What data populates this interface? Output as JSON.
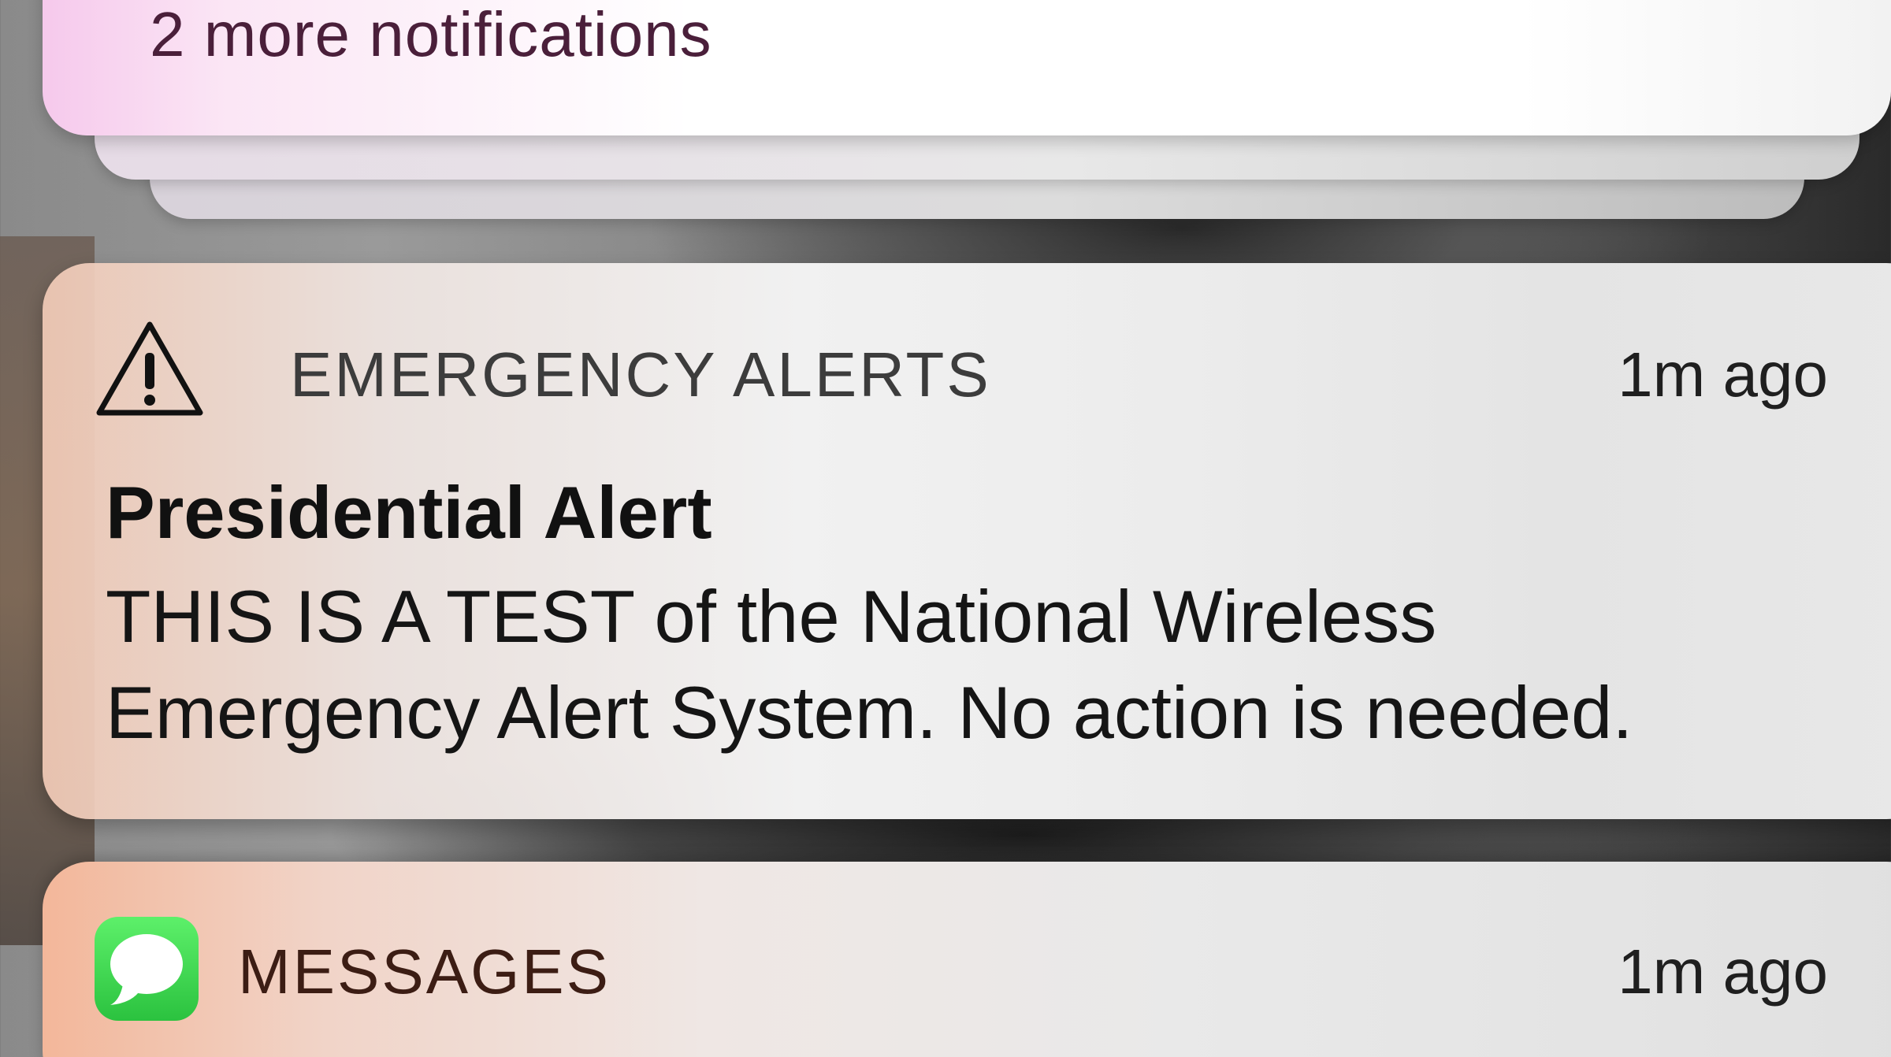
{
  "stack": {
    "more_label": "2 more notifications"
  },
  "alert": {
    "app_name": "EMERGENCY ALERTS",
    "time": "1m ago",
    "icon": "warning-triangle-icon",
    "title": "Presidential Alert",
    "body_line1": "THIS IS A TEST of the National Wireless",
    "body_line2": "Emergency Alert System. No action is needed."
  },
  "messages": {
    "app_name": "MESSAGES",
    "time": "1m ago",
    "icon": "messages-bubble-icon",
    "icon_color": "#2bc23f"
  }
}
